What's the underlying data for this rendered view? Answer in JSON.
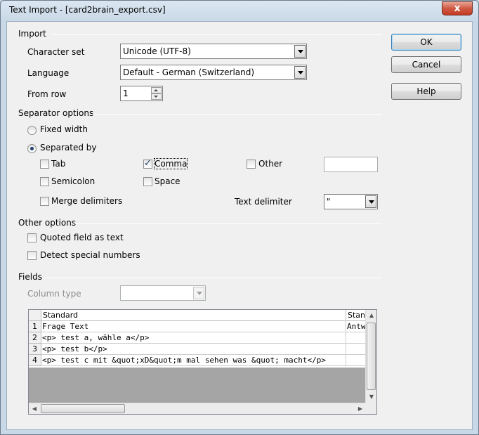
{
  "window": {
    "title": "Text Import - [card2brain_export.csv]",
    "close_glyph": "x"
  },
  "import": {
    "group_label": "Import",
    "character_set": {
      "label": "Character set",
      "value": "Unicode (UTF-8)"
    },
    "language": {
      "label": "Language",
      "value": "Default - German (Switzerland)"
    },
    "from_row": {
      "label": "From row",
      "value": "1"
    }
  },
  "separator_options": {
    "group_label": "Separator options",
    "fixed_width": {
      "label": "Fixed width",
      "selected": false
    },
    "separated_by": {
      "label": "Separated by",
      "selected": true
    },
    "tab": {
      "label": "Tab",
      "checked": false
    },
    "comma": {
      "label": "Comma",
      "checked": true
    },
    "other": {
      "label": "Other",
      "checked": false,
      "value": ""
    },
    "semicolon": {
      "label": "Semicolon",
      "checked": false
    },
    "space": {
      "label": "Space",
      "checked": false
    },
    "merge_delimiters": {
      "label": "Merge delimiters",
      "checked": false
    },
    "text_delimiter": {
      "label": "Text delimiter",
      "value": "\""
    }
  },
  "other_options": {
    "group_label": "Other options",
    "quoted_field": {
      "label": "Quoted field as text",
      "checked": false
    },
    "detect_special": {
      "label": "Detect special numbers",
      "checked": false
    }
  },
  "fields": {
    "group_label": "Fields",
    "column_type": {
      "label": "Column type",
      "value": ""
    },
    "headers": [
      "Standard",
      "Stan"
    ],
    "rows": [
      {
        "num": "1",
        "col1": "Frage Text",
        "col2": "Antw"
      },
      {
        "num": "2",
        "col1": "<p> test a, wähle a</p>",
        "col2": ""
      },
      {
        "num": "3",
        "col1": "<p> test b</p>",
        "col2": ""
      },
      {
        "num": "4",
        "col1": "<p> test c mit &quot;xD&quot;m mal sehen was &quot; macht</p>",
        "col2": ""
      }
    ]
  },
  "buttons": {
    "ok": "OK",
    "cancel": "Cancel",
    "help": "Help"
  },
  "icons": {
    "close": "close-icon",
    "dropdown": "chevron-down-icon",
    "spin_up": "spin-up-icon",
    "spin_down": "spin-down-icon"
  }
}
